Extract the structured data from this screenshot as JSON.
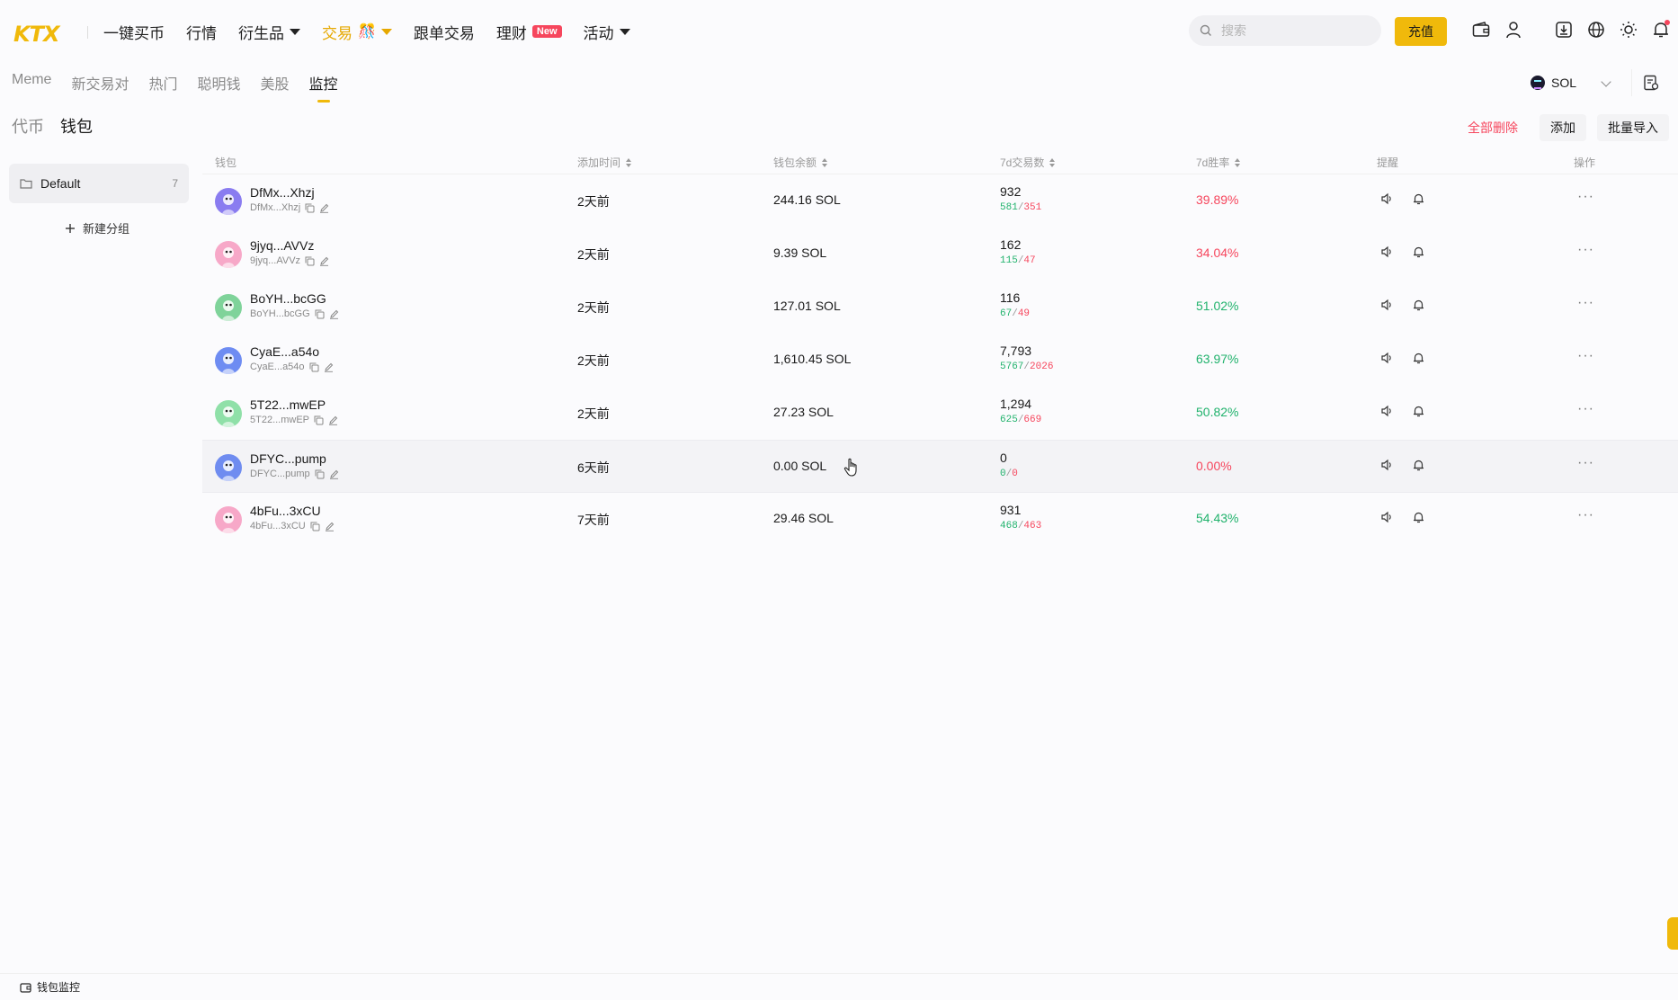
{
  "nav": {
    "logo": "KTX",
    "items": [
      {
        "label": "一键买币",
        "caret": false
      },
      {
        "label": "行情",
        "caret": false
      },
      {
        "label": "衍生品",
        "caret": true
      },
      {
        "label": "交易",
        "caret": true,
        "active": true
      },
      {
        "label": "跟单交易",
        "caret": false
      },
      {
        "label": "理财",
        "badge": "New"
      },
      {
        "label": "活动",
        "caret": true
      }
    ],
    "search_placeholder": "搜索",
    "deposit_label": "充值"
  },
  "subtabs": [
    "Meme",
    "新交易对",
    "热门",
    "聪明钱",
    "美股",
    "监控"
  ],
  "active_subtab": "监控",
  "chain": "SOL",
  "section_tabs": [
    "代币",
    "钱包"
  ],
  "active_section": "钱包",
  "actions": {
    "delete_all": "全部删除",
    "add": "添加",
    "bulk_import": "批量导入"
  },
  "sidebar": {
    "group_name": "Default",
    "group_count": "7",
    "new_group": "新建分组"
  },
  "table": {
    "headers": {
      "wallet": "钱包",
      "added": "添加时间",
      "balance": "钱包余额",
      "tx7d": "7d交易数",
      "winrate": "7d胜率",
      "alert": "提醒",
      "ops": "操作"
    },
    "rows": [
      {
        "name": "DfMx...Xhzj",
        "sub": "DfMx...Xhzj",
        "added": "2天前",
        "balance": "244.16 SOL",
        "tx": "932",
        "wins": "581",
        "losses": "351",
        "rate": "39.89%",
        "rate_color": "red",
        "avatar_bg": "#8a7cf0"
      },
      {
        "name": "9jyq...AVVz",
        "sub": "9jyq...AVVz",
        "added": "2天前",
        "balance": "9.39 SOL",
        "tx": "162",
        "wins": "115",
        "losses": "47",
        "rate": "34.04%",
        "rate_color": "red",
        "avatar_bg": "#f7a8c8"
      },
      {
        "name": "BoYH...bcGG",
        "sub": "BoYH...bcGG",
        "added": "2天前",
        "balance": "127.01 SOL",
        "tx": "116",
        "wins": "67",
        "losses": "49",
        "rate": "51.02%",
        "rate_color": "green",
        "avatar_bg": "#7fd39a"
      },
      {
        "name": "CyaE...a54o",
        "sub": "CyaE...a54o",
        "added": "2天前",
        "balance": "1,610.45 SOL",
        "tx": "7,793",
        "wins": "5767",
        "losses": "2026",
        "rate": "63.97%",
        "rate_color": "green",
        "avatar_bg": "#6e8cf2"
      },
      {
        "name": "5T22...mwEP",
        "sub": "5T22...mwEP",
        "added": "2天前",
        "balance": "27.23 SOL",
        "tx": "1,294",
        "wins": "625",
        "losses": "669",
        "rate": "50.82%",
        "rate_color": "green",
        "avatar_bg": "#8fe0a8"
      },
      {
        "name": "DFYC...pump",
        "sub": "DFYC...pump",
        "added": "6天前",
        "balance": "0.00 SOL",
        "tx": "0",
        "wins": "0",
        "losses": "0",
        "rate": "0.00%",
        "rate_color": "red",
        "avatar_bg": "#6f8cf0",
        "highlight": true
      },
      {
        "name": "4bFu...3xCU",
        "sub": "4bFu...3xCU",
        "added": "7天前",
        "balance": "29.46 SOL",
        "tx": "931",
        "wins": "468",
        "losses": "463",
        "rate": "54.43%",
        "rate_color": "green",
        "avatar_bg": "#f7a8c8"
      }
    ]
  },
  "footer": {
    "label": "钱包监控"
  },
  "colors": {
    "accent": "#f0b90b",
    "green": "#20b26c",
    "red": "#f6465d"
  }
}
